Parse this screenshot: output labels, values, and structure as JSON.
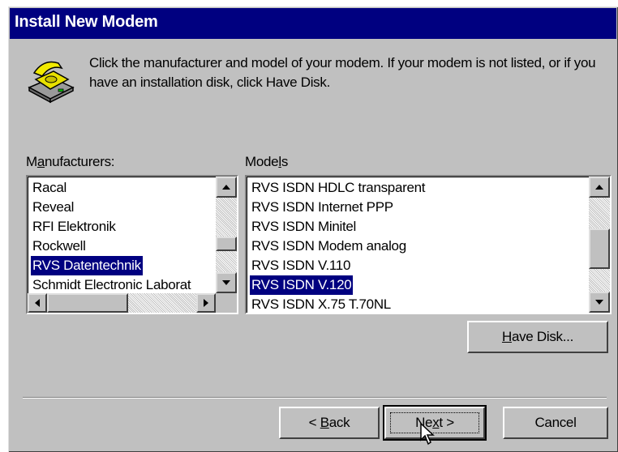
{
  "dialog": {
    "title": "Install New Modem",
    "instructions": "Click the manufacturer and model of your modem. If your modem is not listed, or if you have an installation disk, click Have Disk."
  },
  "manufacturers": {
    "label_prefix": "M",
    "label_accel": "a",
    "label_suffix": "nufacturers:",
    "items": [
      "Racal",
      "Reveal",
      "RFI Elektronik",
      "Rockwell",
      "RVS Datentechnik",
      "Schmidt Electronic Laborat"
    ],
    "selected": "RVS Datentechnik"
  },
  "models": {
    "label_prefix": "Mode",
    "label_accel": "l",
    "label_suffix": "s",
    "items": [
      "RVS ISDN HDLC transparent",
      "RVS ISDN Internet PPP",
      "RVS ISDN Minitel",
      "RVS ISDN Modem analog",
      "RVS ISDN V.110",
      "RVS ISDN V.120",
      "RVS ISDN X.75 T.70NL"
    ],
    "selected": "RVS ISDN V.120"
  },
  "buttons": {
    "have_disk_accel": "H",
    "have_disk_rest": "ave Disk...",
    "back_pre": "< ",
    "back_accel": "B",
    "back_rest": "ack",
    "next_pre": "Ne",
    "next_accel": "x",
    "next_rest": "t >",
    "cancel": "Cancel"
  },
  "icons": [
    "modem-phone-icon",
    "mouse-cursor-icon",
    "scroll-up-arrow-icon",
    "scroll-down-arrow-icon",
    "scroll-left-arrow-icon",
    "scroll-right-arrow-icon"
  ],
  "colors": {
    "face": "#c0c0c0",
    "title": "#000080",
    "selection": "#000080"
  }
}
